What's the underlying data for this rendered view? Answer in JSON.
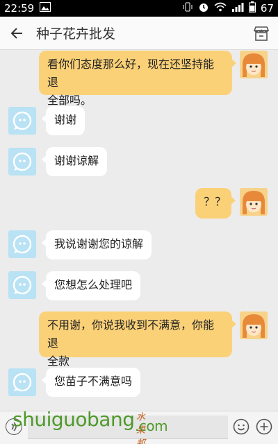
{
  "status_bar": {
    "time": "22:59",
    "battery": "67"
  },
  "header": {
    "title": "种子花卉批发"
  },
  "messages": [
    {
      "from": "me",
      "line1": "看你们态度那么好，现在还坚持能退",
      "line2": "全部吗。"
    },
    {
      "from": "them",
      "text": "谢谢"
    },
    {
      "from": "them",
      "text": "谢谢谅解"
    },
    {
      "from": "me",
      "text": "？？"
    },
    {
      "from": "them",
      "text": "我说谢谢您的谅解"
    },
    {
      "from": "them",
      "text": "您想怎么处理吧"
    },
    {
      "from": "me",
      "line1": "不用谢，你说我收到不满意，你能退",
      "line2": "全款"
    },
    {
      "from": "them",
      "text": "您苗子不满意吗"
    }
  ],
  "input": {
    "placeholder": ""
  },
  "watermark": {
    "main": "shuiguobang",
    "cn": "水果邦",
    "com": ".com"
  },
  "icons": {
    "back": "arrow-left-icon",
    "shop": "shop-icon",
    "voice": "voice-icon",
    "emoji": "emoji-icon",
    "plus": "plus-icon"
  }
}
